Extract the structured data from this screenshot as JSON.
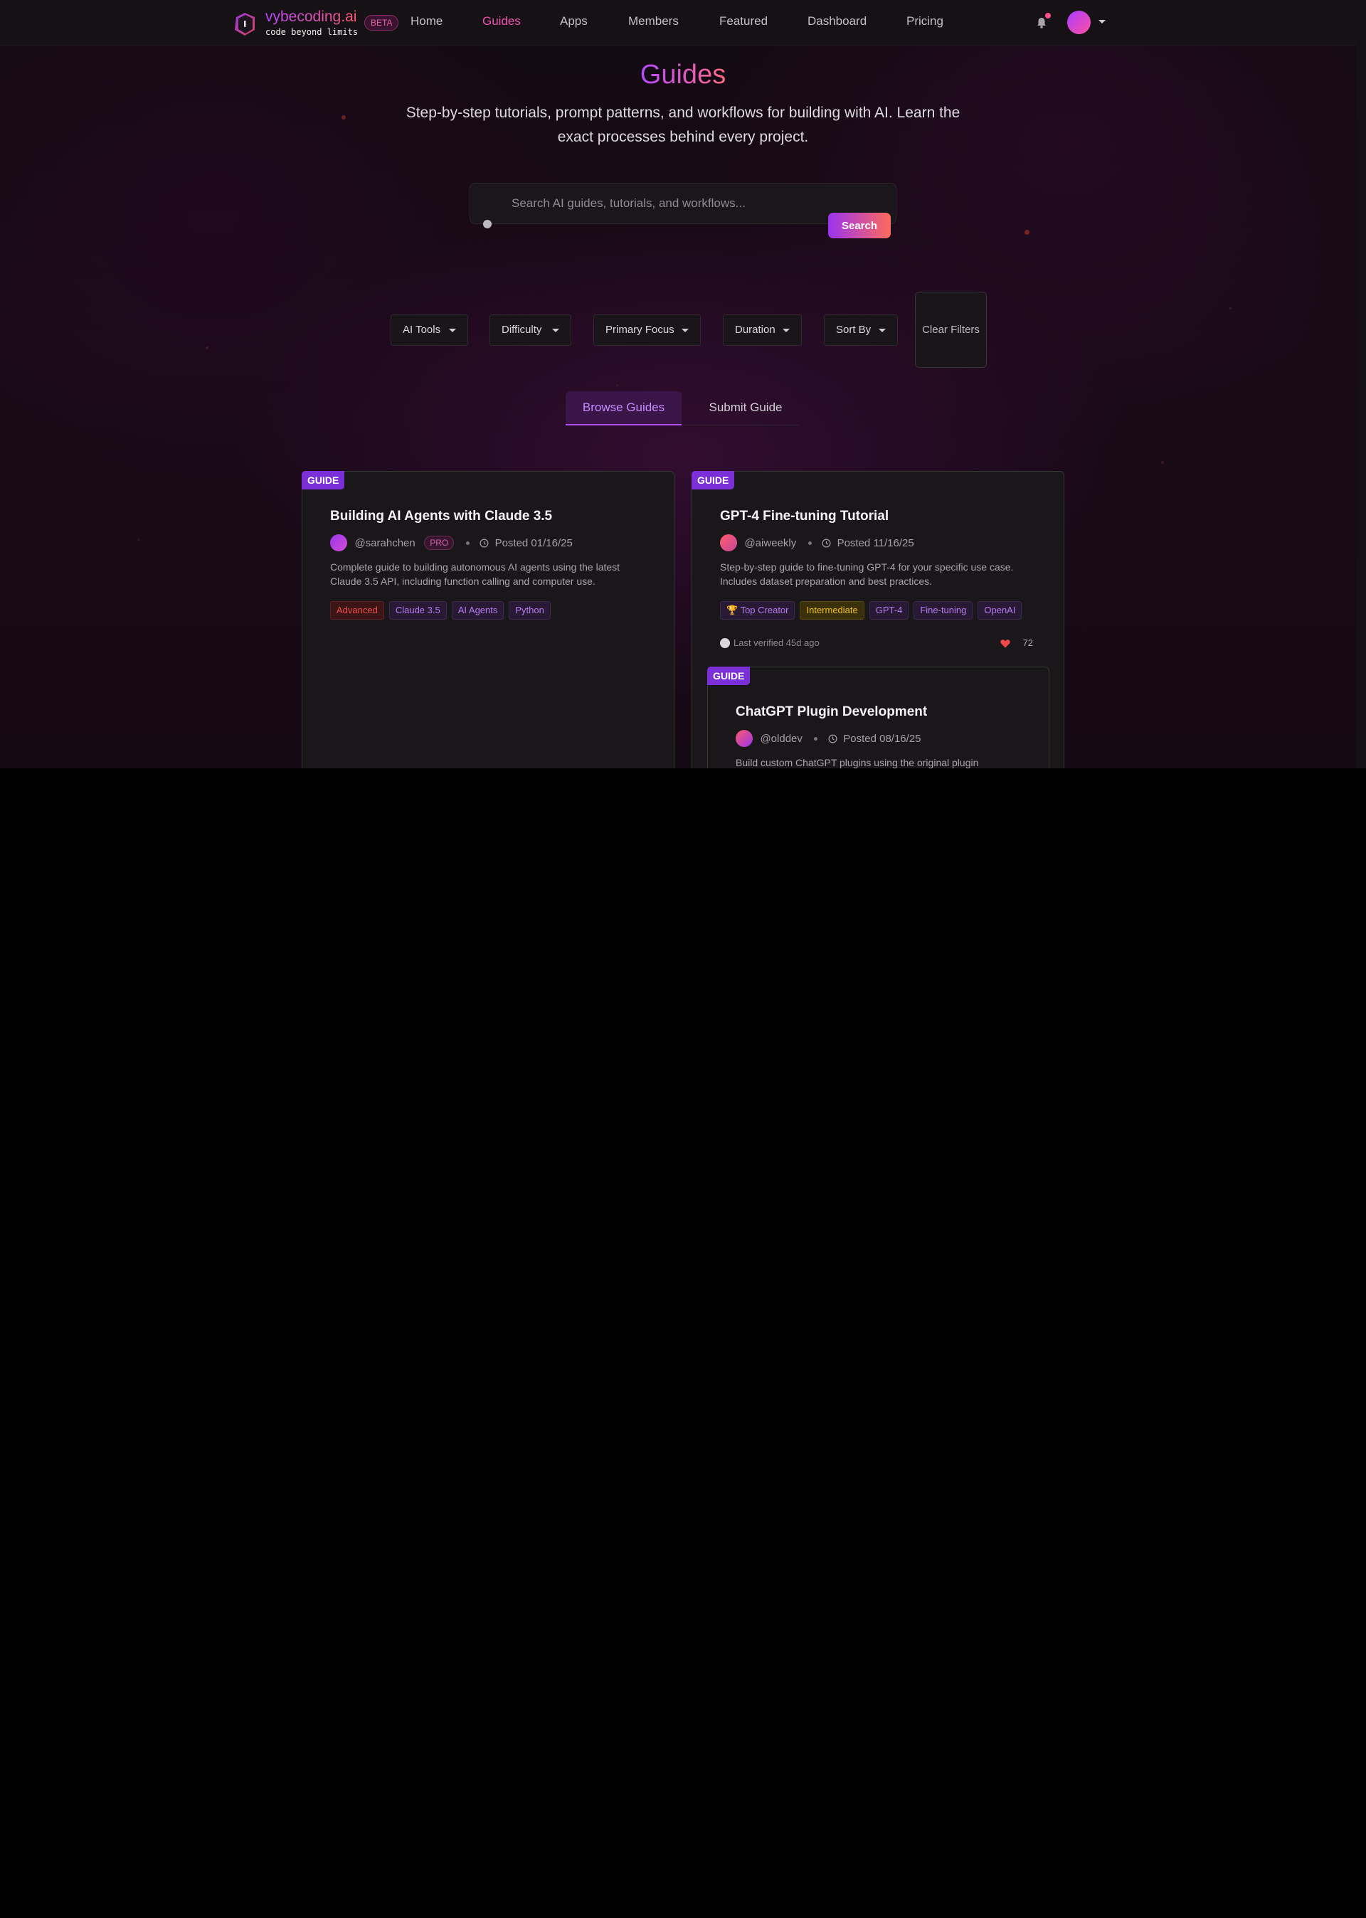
{
  "nav": {
    "brand_name": "vybecoding.ai",
    "brand_tagline": "code beyond limits",
    "beta_label": "BETA",
    "links": [
      {
        "label": "Home",
        "active": false
      },
      {
        "label": "Guides",
        "active": true
      },
      {
        "label": "Apps",
        "active": false
      },
      {
        "label": "Members",
        "active": false
      },
      {
        "label": "Featured",
        "active": false
      },
      {
        "label": "Dashboard",
        "active": false
      },
      {
        "label": "Pricing",
        "active": false
      }
    ],
    "bell_icon": "bell-icon",
    "has_notification": true
  },
  "hero": {
    "title": "Guides",
    "subtitle": "Step-by-step tutorials, prompt patterns, and workflows for building with AI. Learn the exact processes behind every project."
  },
  "search": {
    "placeholder": "Search AI guides, tutorials, and workflows...",
    "value": "",
    "button_label": "Search"
  },
  "filters": {
    "items": [
      "AI Tools",
      "Difficulty",
      "Primary Focus",
      "Duration",
      "Sort By"
    ],
    "clear_label": "Clear Filters"
  },
  "tabs": [
    {
      "label": "Browse Guides",
      "active": true
    },
    {
      "label": "Submit Guide",
      "active": false
    }
  ],
  "cards": [
    {
      "badge": "GUIDE",
      "title": "Building AI Agents with Claude 3.5",
      "author": "@sarahchen",
      "author_badge": "PRO",
      "posted": "Posted 01/16/25",
      "description": "Complete guide to building autonomous AI agents using the latest Claude 3.5 API, including function calling and computer use.",
      "tags": [
        {
          "label": "Advanced",
          "color": "red"
        },
        {
          "label": "Claude 3.5",
          "color": "purple"
        },
        {
          "label": "AI Agents",
          "color": "purple"
        },
        {
          "label": "Python",
          "color": "purple"
        }
      ]
    },
    {
      "badge": "GUIDE",
      "title": "GPT-4 Fine-tuning Tutorial",
      "author": "@aiweekly",
      "posted": "Posted 11/16/25",
      "description": "Step-by-step guide to fine-tuning GPT-4 for your specific use case. Includes dataset preparation and best practices.",
      "tags": [
        {
          "label": "🏆 Top Creator",
          "color": "purple"
        },
        {
          "label": "Intermediate",
          "color": "yellow"
        },
        {
          "label": "GPT-4",
          "color": "purple"
        },
        {
          "label": "Fine-tuning",
          "color": "purple"
        },
        {
          "label": "OpenAI",
          "color": "purple"
        }
      ],
      "verified": "Last verified 45d ago",
      "likes": "72"
    },
    {
      "badge": "GUIDE",
      "title": "ChatGPT Plugin Development",
      "author": "@olddev",
      "posted": "Posted 08/16/25",
      "description": "Build custom ChatGPT plugins using the original plugin"
    }
  ],
  "colors": {
    "accent_purple": "#9b33f0",
    "accent_pink": "#f055b4",
    "accent_coral": "#ff6a5c",
    "background": "#1a0a18"
  }
}
